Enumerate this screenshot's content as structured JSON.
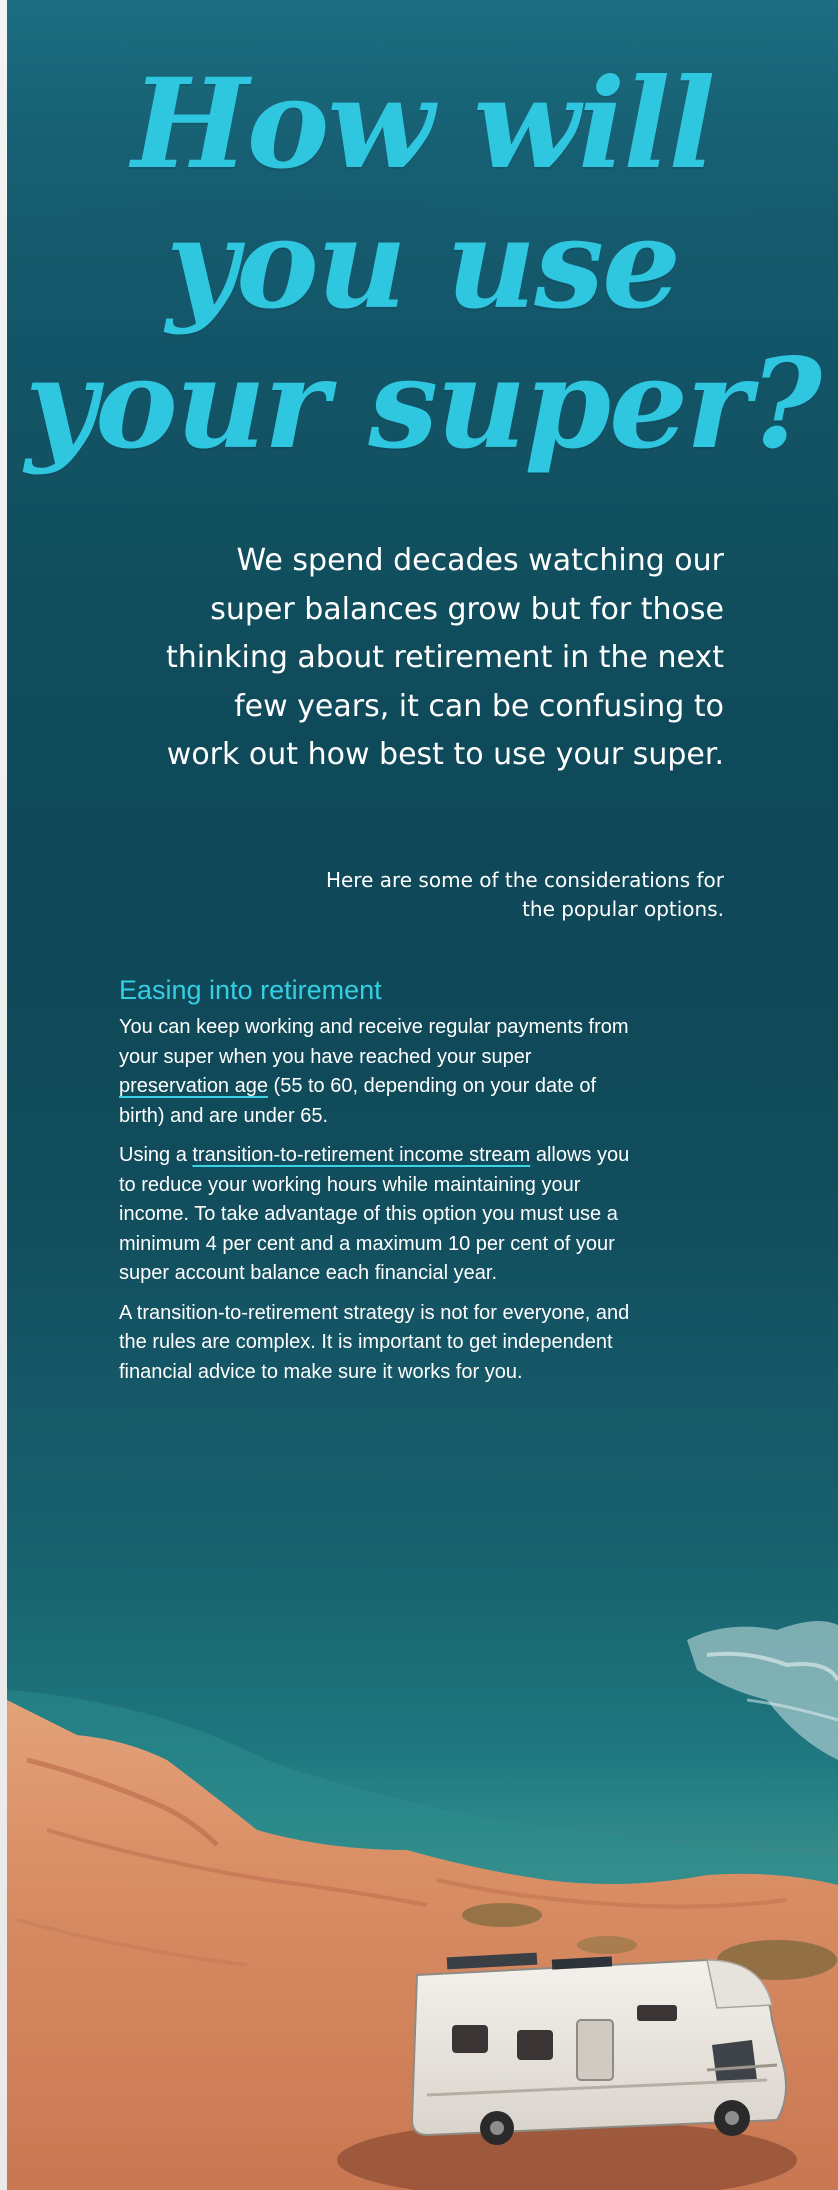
{
  "headline": {
    "line1": "How will",
    "line2": "you use",
    "line3": "your super?"
  },
  "intro": "We spend decades watching our super balances grow but for those thinking about retirement in the next few years, it can be confusing to work out how best to use your super.",
  "sub_intro": "Here are some of the considerations for the popular options.",
  "section": {
    "title": "Easing into retirement",
    "p1": {
      "before": "You can keep working and receive regular payments from your super when you have reached your super ",
      "link": "preservation age",
      "after": " (55 to 60, depending on your date of birth) and are under 65."
    },
    "p2": {
      "before": "Using a ",
      "link": "transition-to-retirement income stream",
      "after": " allows you to reduce your working hours while maintaining your income. To take advantage of this option you must use a minimum 4 per cent and a maximum 10 per cent of your super account balance each financial year."
    },
    "p3": "A transition-to-retirement strategy is not for everyone, and the rules are complex. It is important to get independent financial advice to make sure it works for you."
  },
  "colors": {
    "headline": "#2fc6e0",
    "subheading": "#35cfe4",
    "sea_dark": "#0f4858",
    "cliff": "#d98e64"
  }
}
